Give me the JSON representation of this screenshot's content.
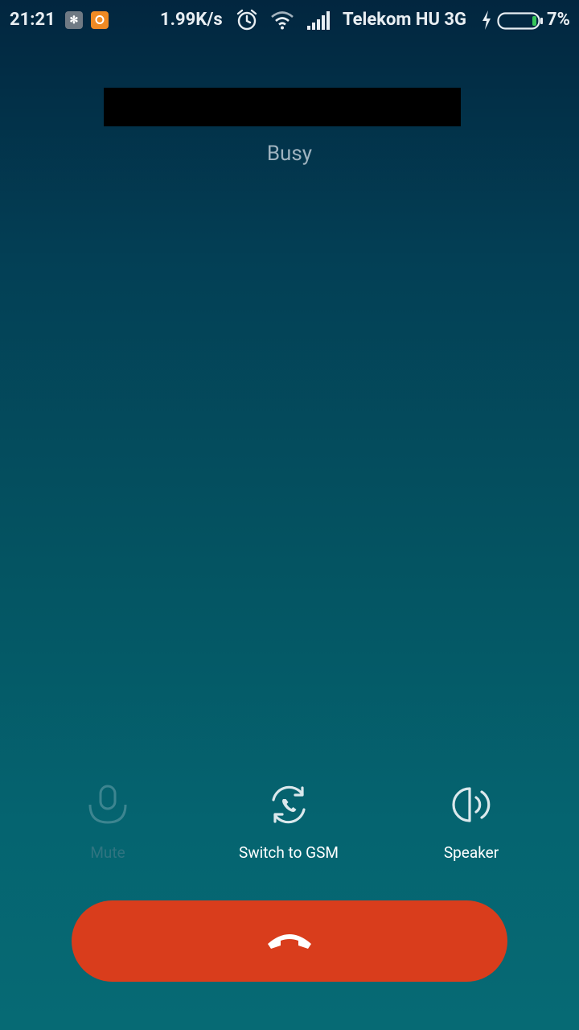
{
  "status_bar": {
    "time": "21:21",
    "net_speed": "1.99K/s",
    "carrier": "Telekom HU 3G",
    "battery_percent": "7%",
    "battery_level": 0.07,
    "icons": [
      "app-notification-icon",
      "chat-notification-icon",
      "alarm-icon",
      "wifi-icon",
      "signal-icon",
      "charging-icon",
      "battery-icon"
    ]
  },
  "call": {
    "caller_name": "",
    "status": "Busy"
  },
  "controls": {
    "mute_label": "Mute",
    "mute_enabled": false,
    "switch_label": "Switch to GSM",
    "speaker_label": "Speaker"
  },
  "colors": {
    "end_call": "#d93d1c",
    "background_top": "#02263f",
    "background_bottom": "#066a74"
  }
}
